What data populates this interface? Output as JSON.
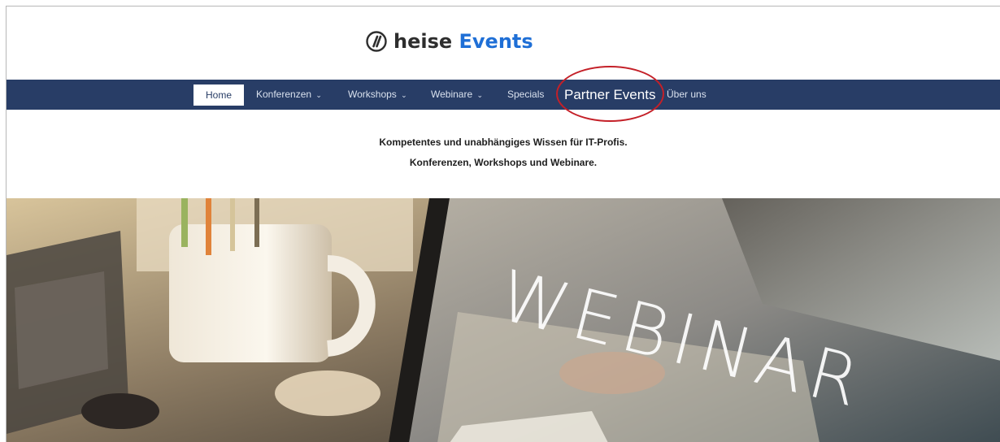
{
  "brand": {
    "name_part1": "heise",
    "name_part2": "Events",
    "icon": "heise-logo-icon"
  },
  "nav": {
    "items": [
      {
        "label": "Home",
        "caret": ""
      },
      {
        "label": "Konferenzen",
        "caret": "⌄"
      },
      {
        "label": "Workshops",
        "caret": "⌄"
      },
      {
        "label": "Webinare",
        "caret": "⌄"
      },
      {
        "label": "Specials",
        "caret": ""
      },
      {
        "label": "Partner Events",
        "caret": ""
      },
      {
        "label": "Über uns",
        "caret": ""
      }
    ]
  },
  "tagline": {
    "line1": "Kompetentes und unabhängiges Wissen für IT-Profis.",
    "line2": "Konferenzen, Workshops und Webinare."
  },
  "hero": {
    "title": "WEBINAR"
  },
  "colors": {
    "navbar": "#283d66",
    "brand_accent": "#1f6fd6",
    "highlight": "#c42028"
  }
}
